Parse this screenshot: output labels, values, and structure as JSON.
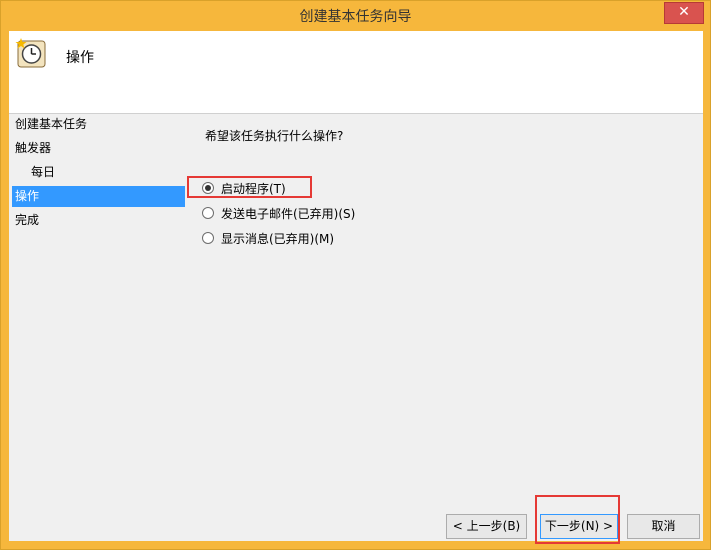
{
  "window": {
    "title": "创建基本任务向导"
  },
  "header": {
    "title": "操作",
    "icon": "scheduled-task-clock-icon"
  },
  "nav": {
    "items": [
      {
        "label": "创建基本任务"
      },
      {
        "label": "触发器"
      },
      {
        "label": "每日"
      },
      {
        "label": "操作"
      },
      {
        "label": "完成"
      }
    ]
  },
  "main": {
    "question": "希望该任务执行什么操作?",
    "options": [
      {
        "label": "启动程序(T)",
        "checked": true
      },
      {
        "label": "发送电子邮件(已弃用)(S)",
        "checked": false
      },
      {
        "label": "显示消息(已弃用)(M)",
        "checked": false
      }
    ]
  },
  "buttons": {
    "back": "< 上一步(B)",
    "next": "下一步(N) >",
    "cancel": "取消"
  },
  "colors": {
    "title_bar": "#f6b73c",
    "selection": "#3399ff",
    "highlight": "#e53935"
  }
}
